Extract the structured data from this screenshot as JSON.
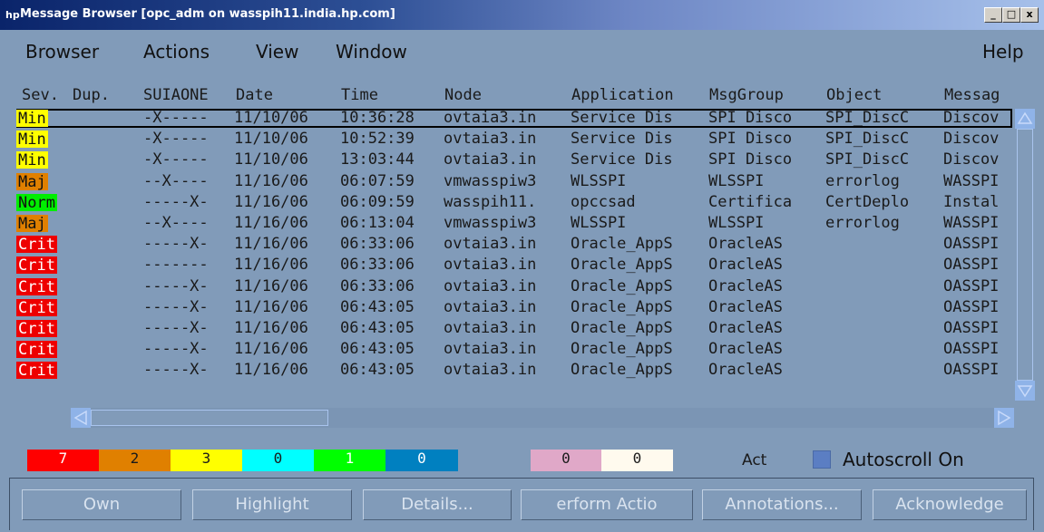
{
  "window": {
    "title": "Message Browser  [opc_adm on wasspih11.india.hp.com]",
    "icon": "hp-icon",
    "controls": [
      "_",
      "□",
      "x"
    ]
  },
  "menu": {
    "browser": "Browser",
    "actions": "Actions",
    "view": "View",
    "window": "Window",
    "help": "Help"
  },
  "columns": {
    "sev": "Sev.",
    "dup": "Dup.",
    "suiaone": "SUIAONE",
    "date": "Date",
    "time": "Time",
    "node": "Node",
    "application": "Application",
    "msggroup": "MsgGroup",
    "object": "Object",
    "message": "Messag"
  },
  "severity_colors": {
    "Min": "#ffff00",
    "Maj": "#e08000",
    "Norm": "#00ee00",
    "Crit": "#ee0000"
  },
  "rows": [
    {
      "sev": "Min",
      "flags": "-X-----",
      "date": "11/10/06",
      "time": "10:36:28",
      "node": "ovtaia3.in",
      "app": "Service Dis",
      "group": "SPI Disco",
      "object": "SPI_DiscC",
      "msg": "Discov"
    },
    {
      "sev": "Min",
      "flags": "-X-----",
      "date": "11/10/06",
      "time": "10:52:39",
      "node": "ovtaia3.in",
      "app": "Service Dis",
      "group": "SPI Disco",
      "object": "SPI_DiscC",
      "msg": "Discov"
    },
    {
      "sev": "Min",
      "flags": "-X-----",
      "date": "11/10/06",
      "time": "13:03:44",
      "node": "ovtaia3.in",
      "app": "Service Dis",
      "group": "SPI Disco",
      "object": "SPI_DiscC",
      "msg": "Discov"
    },
    {
      "sev": "Maj",
      "flags": "--X----",
      "date": "11/16/06",
      "time": "06:07:59",
      "node": "vmwasspiw3",
      "app": "WLSSPI",
      "group": "WLSSPI",
      "object": "errorlog",
      "msg": "WASSPI"
    },
    {
      "sev": "Norm",
      "flags": "-----X-",
      "date": "11/16/06",
      "time": "06:09:59",
      "node": "wasspih11.",
      "app": "opccsad",
      "group": "Certifica",
      "object": "CertDeplo",
      "msg": "Instal"
    },
    {
      "sev": "Maj",
      "flags": "--X----",
      "date": "11/16/06",
      "time": "06:13:04",
      "node": "vmwasspiw3",
      "app": "WLSSPI",
      "group": "WLSSPI",
      "object": "errorlog",
      "msg": "WASSPI"
    },
    {
      "sev": "Crit",
      "flags": "-----X-",
      "date": "11/16/06",
      "time": "06:33:06",
      "node": "ovtaia3.in",
      "app": "Oracle_AppS",
      "group": "OracleAS",
      "object": "",
      "msg": "OASSPI"
    },
    {
      "sev": "Crit",
      "flags": "-------",
      "date": "11/16/06",
      "time": "06:33:06",
      "node": "ovtaia3.in",
      "app": "Oracle_AppS",
      "group": "OracleAS",
      "object": "",
      "msg": "OASSPI"
    },
    {
      "sev": "Crit",
      "flags": "-----X-",
      "date": "11/16/06",
      "time": "06:33:06",
      "node": "ovtaia3.in",
      "app": "Oracle_AppS",
      "group": "OracleAS",
      "object": "",
      "msg": "OASSPI"
    },
    {
      "sev": "Crit",
      "flags": "-----X-",
      "date": "11/16/06",
      "time": "06:43:05",
      "node": "ovtaia3.in",
      "app": "Oracle_AppS",
      "group": "OracleAS",
      "object": "",
      "msg": "OASSPI"
    },
    {
      "sev": "Crit",
      "flags": "-----X-",
      "date": "11/16/06",
      "time": "06:43:05",
      "node": "ovtaia3.in",
      "app": "Oracle_AppS",
      "group": "OracleAS",
      "object": "",
      "msg": "OASSPI"
    },
    {
      "sev": "Crit",
      "flags": "-----X-",
      "date": "11/16/06",
      "time": "06:43:05",
      "node": "ovtaia3.in",
      "app": "Oracle_AppS",
      "group": "OracleAS",
      "object": "",
      "msg": "OASSPI"
    },
    {
      "sev": "Crit",
      "flags": "-----X-",
      "date": "11/16/06",
      "time": "06:43:05",
      "node": "ovtaia3.in",
      "app": "Oracle_AppS",
      "group": "OracleAS",
      "object": "",
      "msg": "OASSPI"
    }
  ],
  "status": {
    "counts": [
      {
        "name": "critical",
        "value": "7",
        "color": "#ff0000"
      },
      {
        "name": "major",
        "value": "2",
        "color": "#e08000"
      },
      {
        "name": "minor",
        "value": "3",
        "color": "#ffff00"
      },
      {
        "name": "warning",
        "value": "0",
        "color": "#00ffff"
      },
      {
        "name": "normal",
        "value": "1",
        "color": "#00ff00"
      },
      {
        "name": "unknown",
        "value": "0",
        "color": "#0080c0"
      },
      {
        "name": "pink",
        "value": "0",
        "color": "#e0a8c8"
      },
      {
        "name": "white",
        "value": "0",
        "color": "#fffaee"
      }
    ],
    "act": "Act",
    "autoscroll": "Autoscroll On"
  },
  "buttons": {
    "own": "Own",
    "highlight": "Highlight",
    "details": "Details...",
    "perform": "erform Actio",
    "annotations": "Annotations...",
    "acknowledge": "Acknowledge"
  }
}
